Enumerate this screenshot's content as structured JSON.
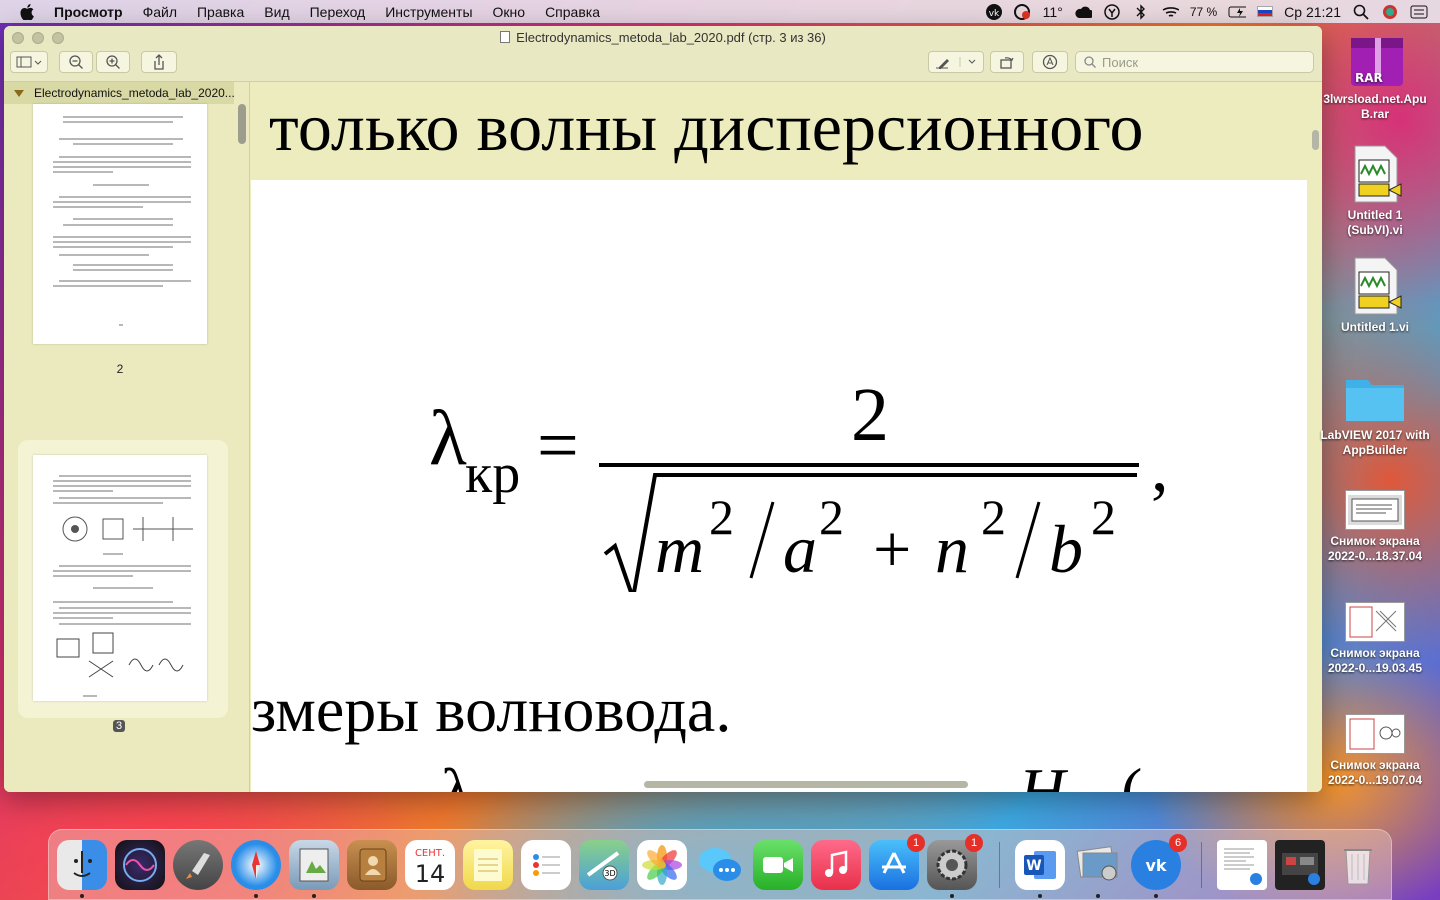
{
  "menubar": {
    "app_name": "Просмотр",
    "items": [
      "Файл",
      "Правка",
      "Вид",
      "Переход",
      "Инструменты",
      "Окно",
      "Справка"
    ],
    "temperature": "11°",
    "battery": "77 %",
    "clock": "Ср 21:21"
  },
  "window": {
    "title": "Electrodynamics_metoda_lab_2020.pdf (стр. 3 из 36)",
    "search_placeholder": "Поиск",
    "sidebar_header": "Electrodynamics_metoda_lab_2020...",
    "thumbnails": [
      {
        "page": "2",
        "selected": false
      },
      {
        "page": "3",
        "selected": true
      }
    ]
  },
  "document": {
    "top_line": "только волны дисперсионного",
    "formula": {
      "lambda": "λ",
      "subscript": "кр",
      "equals": "=",
      "numerator": "2",
      "denominator": "m²/a² + n²/b²",
      "trailing": ","
    },
    "bottom_line": "змеры волновода."
  },
  "desktop_icons": [
    {
      "label": "3lwrsload.net.Apu B.rar",
      "badge_text": "RAR"
    },
    {
      "label": "Untitled 1 (SubVI).vi"
    },
    {
      "label": "Untitled 1.vi"
    },
    {
      "label": "LabVIEW 2017 with AppBuilder"
    },
    {
      "label": "Снимок экрана 2022-0...18.37.04"
    },
    {
      "label": "Снимок экрана 2022-0...19.03.45"
    },
    {
      "label": "Снимок экрана 2022-0...19.07.04"
    }
  ],
  "dock": {
    "calendar_month": "СЕНТ.",
    "calendar_day": "14",
    "appstore_badge": "1",
    "settings_badge": "1",
    "vk_badge": "6"
  }
}
